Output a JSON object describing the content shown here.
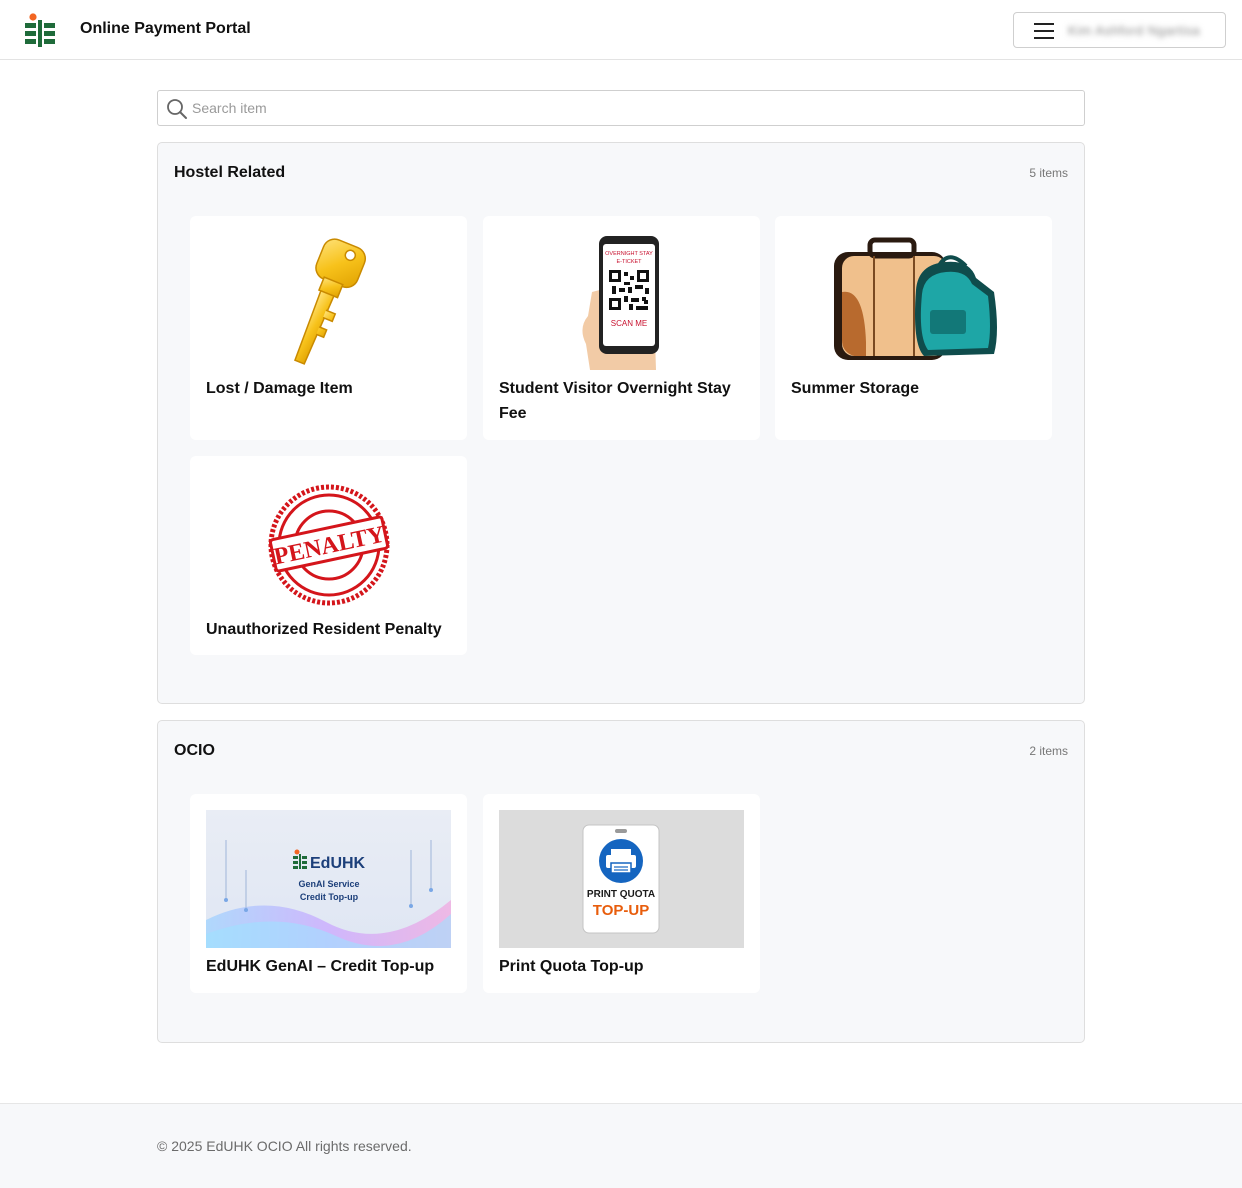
{
  "header": {
    "title": "Online Payment Portal",
    "user_name": "Kim Ashford Ngartisa"
  },
  "search": {
    "placeholder": "Search item"
  },
  "sections": [
    {
      "title": "Hostel Related",
      "count": "5 items",
      "items": [
        {
          "title": "Lost / Damage Item",
          "icon": "key-icon"
        },
        {
          "title": "Student Visitor Overnight Stay Fee",
          "icon": "qr-ticket-phone-icon",
          "image_text": [
            "OVERNIGHT STAY",
            "E-TICKET",
            "SCAN ME"
          ]
        },
        {
          "title": "Summer Storage",
          "icon": "luggage-icon"
        },
        {
          "title": "Unauthorized Resident Penalty",
          "icon": "penalty-stamp-icon",
          "image_text": [
            "PENALTY"
          ]
        }
      ]
    },
    {
      "title": "OCIO",
      "count": "2 items",
      "items": [
        {
          "title": "EdUHK GenAI – Credit Top-up",
          "icon": "genai-banner-icon",
          "image_text": [
            "EdUHK",
            "GenAI Service",
            "Credit Top-up"
          ]
        },
        {
          "title": "Print Quota Top-up",
          "icon": "print-quota-icon",
          "image_text": [
            "PRINT QUOTA",
            "TOP-UP"
          ]
        }
      ]
    }
  ],
  "colors": {
    "brand_green": "#1f6b3a",
    "brand_orange": "#f26522",
    "panel_bg": "#f7f8fa"
  },
  "footer": {
    "text": "© 2025 EdUHK OCIO All rights reserved."
  }
}
